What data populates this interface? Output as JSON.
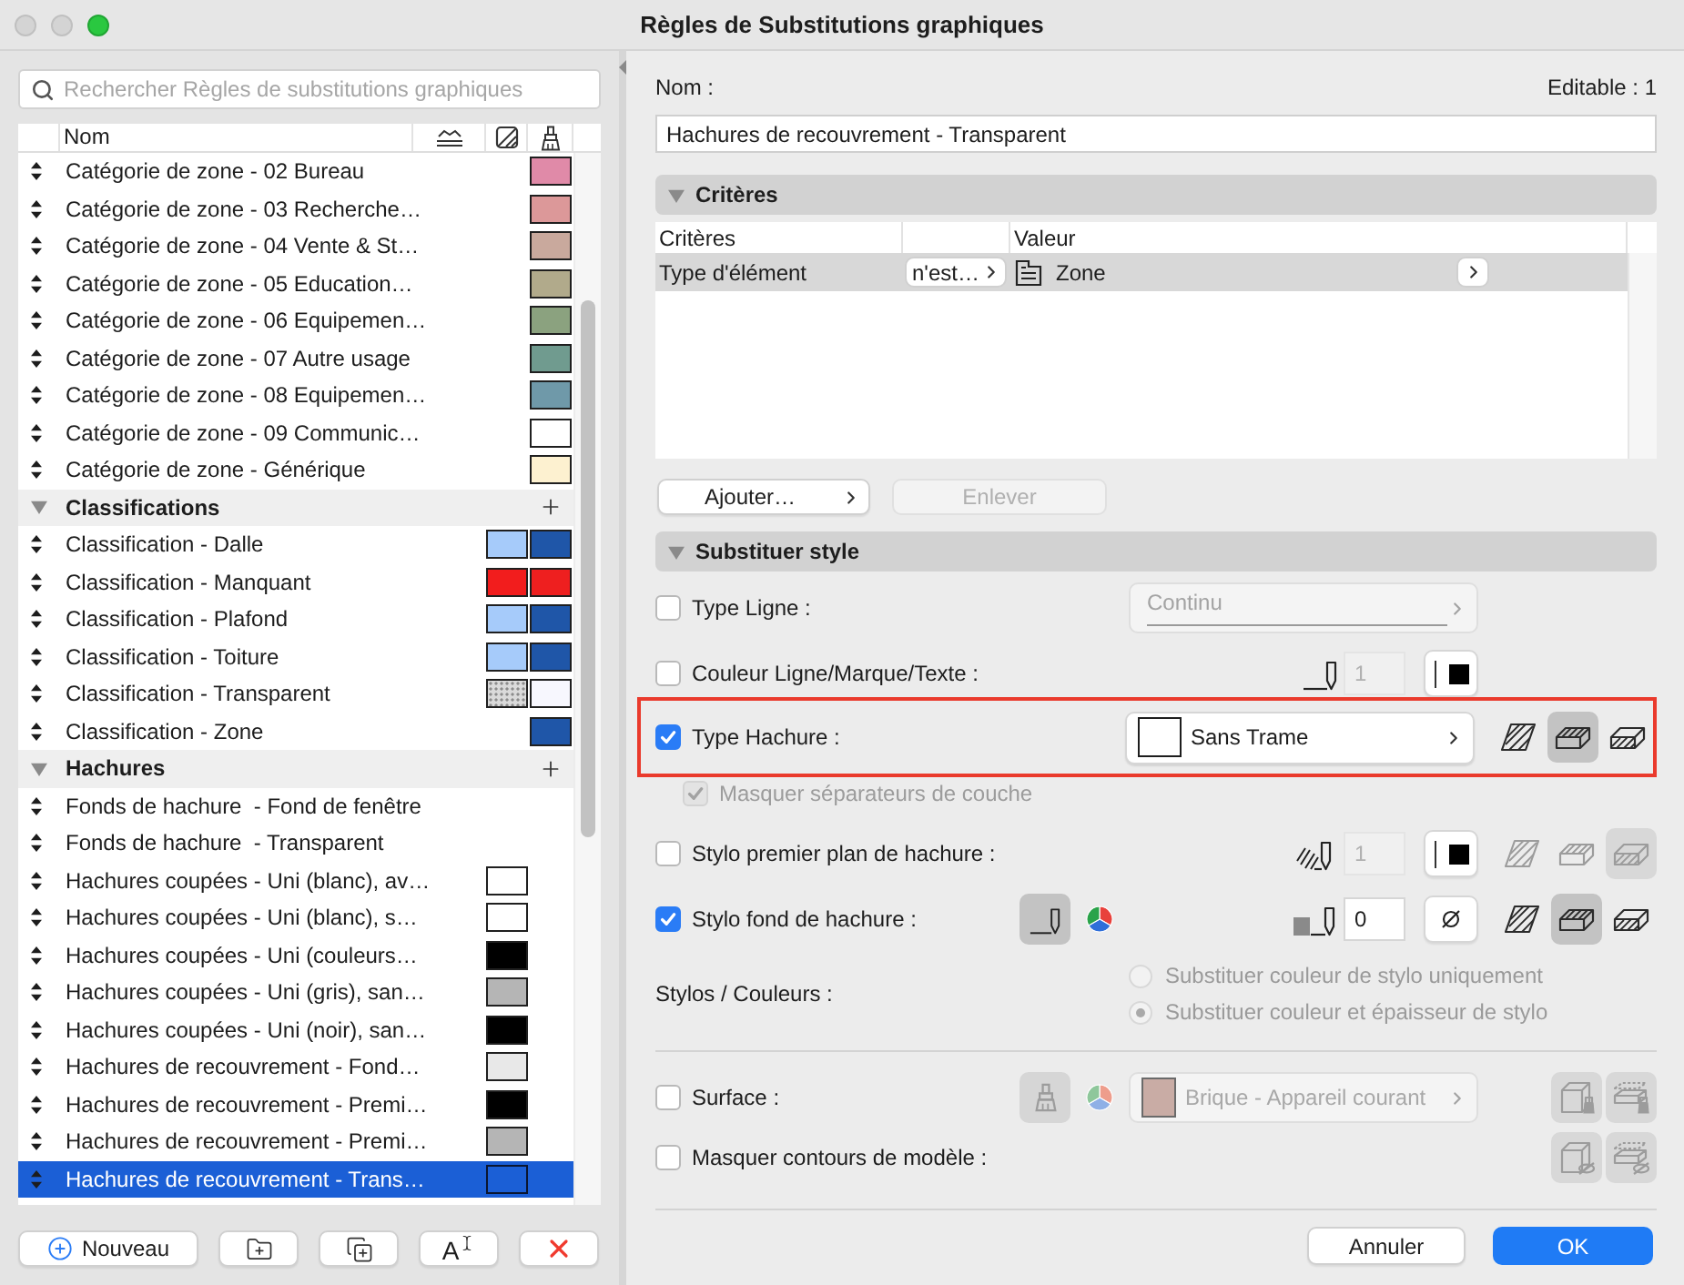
{
  "window": {
    "title": "Règles de Substitutions graphiques"
  },
  "rules_panel": {
    "search": {
      "placeholder": "Rechercher Règles de substitutions graphiques"
    },
    "name_column": "Nom",
    "rows": [
      {
        "kind": "rule",
        "name": "Catégorie de zone - 02 Bureau",
        "selected": false,
        "surface_swatch": {
          "kind": "solid",
          "color": "#e08aa8"
        }
      },
      {
        "kind": "rule",
        "name": "Catégorie de zone - 03 Recherche…",
        "selected": false,
        "surface_swatch": {
          "kind": "solid",
          "color": "#dc9899"
        }
      },
      {
        "kind": "rule",
        "name": "Catégorie de zone - 04 Vente & St…",
        "selected": false,
        "surface_swatch": {
          "kind": "solid",
          "color": "#c9a99d"
        }
      },
      {
        "kind": "rule",
        "name": "Catégorie de zone - 05 Education…",
        "selected": false,
        "surface_swatch": {
          "kind": "solid",
          "color": "#b1aa8b"
        }
      },
      {
        "kind": "rule",
        "name": "Catégorie de zone - 06 Equipemen…",
        "selected": false,
        "surface_swatch": {
          "kind": "solid",
          "color": "#8ba27f"
        }
      },
      {
        "kind": "rule",
        "name": "Catégorie de zone - 07 Autre usage",
        "selected": false,
        "surface_swatch": {
          "kind": "solid",
          "color": "#709b8f"
        }
      },
      {
        "kind": "rule",
        "name": "Catégorie de zone - 08 Equipemen…",
        "selected": false,
        "surface_swatch": {
          "kind": "solid",
          "color": "#6f99a9"
        }
      },
      {
        "kind": "rule",
        "name": "Catégorie de zone - 09 Communic…",
        "selected": false,
        "surface_swatch": {
          "kind": "solid",
          "color": "#ffffff"
        }
      },
      {
        "kind": "rule",
        "name": "Catégorie de zone - Générique",
        "selected": false,
        "surface_swatch": {
          "kind": "solid",
          "color": "#fdf1d0"
        }
      },
      {
        "kind": "group",
        "name": "Classifications",
        "expanded": true
      },
      {
        "kind": "rule",
        "name": "Classification - Dalle",
        "selected": false,
        "fill_swatch": {
          "kind": "solid",
          "color": "#a6cbfa"
        },
        "surface_swatch": {
          "kind": "solid",
          "color": "#1f56a8"
        }
      },
      {
        "kind": "rule",
        "name": "Classification - Manquant",
        "selected": false,
        "fill_swatch": {
          "kind": "solid",
          "color": "#f21d1d"
        },
        "surface_swatch": {
          "kind": "solid",
          "color": "#ee1f1f"
        }
      },
      {
        "kind": "rule",
        "name": "Classification - Plafond",
        "selected": false,
        "fill_swatch": {
          "kind": "solid",
          "color": "#a6cbfa"
        },
        "surface_swatch": {
          "kind": "solid",
          "color": "#1f56a8"
        }
      },
      {
        "kind": "rule",
        "name": "Classification - Toiture",
        "selected": false,
        "fill_swatch": {
          "kind": "solid",
          "color": "#a6cbfa"
        },
        "surface_swatch": {
          "kind": "solid",
          "color": "#1f56a8"
        }
      },
      {
        "kind": "rule",
        "name": "Classification - Transparent",
        "selected": false,
        "fill_swatch": {
          "kind": "dotted",
          "color": "#dadada"
        },
        "surface_swatch": {
          "kind": "solid",
          "color": "#f7f7fe"
        }
      },
      {
        "kind": "rule",
        "name": "Classification - Zone",
        "selected": false,
        "surface_swatch": {
          "kind": "solid",
          "color": "#1f56a8"
        }
      },
      {
        "kind": "group",
        "name": "Hachures",
        "expanded": true
      },
      {
        "kind": "rule",
        "name": "Fonds de hachure  - Fond de fenêtre",
        "selected": false
      },
      {
        "kind": "rule",
        "name": "Fonds de hachure  - Transparent",
        "selected": false
      },
      {
        "kind": "rule",
        "name": "Hachures coupées - Uni (blanc), av…",
        "selected": false,
        "fill_swatch": {
          "kind": "solid",
          "color": "#ffffff"
        }
      },
      {
        "kind": "rule",
        "name": "Hachures coupées - Uni (blanc), s…",
        "selected": false,
        "fill_swatch": {
          "kind": "solid",
          "color": "#ffffff"
        }
      },
      {
        "kind": "rule",
        "name": "Hachures coupées - Uni (couleurs…",
        "selected": false,
        "fill_swatch": {
          "kind": "solid",
          "color": "#000000"
        }
      },
      {
        "kind": "rule",
        "name": "Hachures coupées - Uni (gris), san…",
        "selected": false,
        "fill_swatch": {
          "kind": "solid",
          "color": "#b5b5b5"
        }
      },
      {
        "kind": "rule",
        "name": "Hachures coupées - Uni (noir), san…",
        "selected": false,
        "fill_swatch": {
          "kind": "solid",
          "color": "#000000"
        }
      },
      {
        "kind": "rule",
        "name": "Hachures de recouvrement - Fond…",
        "selected": false,
        "fill_swatch": {
          "kind": "solid",
          "color": "#e8e8e8"
        }
      },
      {
        "kind": "rule",
        "name": "Hachures de recouvrement - Premi…",
        "selected": false,
        "fill_swatch": {
          "kind": "solid",
          "color": "#000000"
        }
      },
      {
        "kind": "rule",
        "name": "Hachures de recouvrement - Premi…",
        "selected": false,
        "fill_swatch": {
          "kind": "solid",
          "color": "#b5b5b5"
        }
      },
      {
        "kind": "rule",
        "name": "Hachures de recouvrement - Trans…",
        "selected": true,
        "fill_swatch": {
          "kind": "empty"
        }
      }
    ],
    "buttons": {
      "new": "Nouveau",
      "rename": "A"
    }
  },
  "editor": {
    "name_label": "Nom :",
    "editable": "Editable : 1",
    "name_value": "Hachures de recouvrement - Transparent",
    "criteria": {
      "title": "Critères",
      "expanded": true,
      "criterion_header": "Critères",
      "value_header": "Valeur",
      "rows": [
        {
          "criterion": "Type d'élément",
          "operator": "n'est…",
          "value": "Zone",
          "selected": true
        }
      ],
      "add_button": "Ajouter…",
      "remove_button": {
        "label": "Enlever",
        "disabled": true
      }
    },
    "style": {
      "title": "Substituer style",
      "expanded": true,
      "rows": [
        {
          "kind": "line_type",
          "label": "Type Ligne :",
          "checked": false,
          "popup": {
            "value": "Continu"
          }
        },
        {
          "kind": "pen_color",
          "label": "Couleur Ligne/Marque/Texte :",
          "checked": false,
          "pen_number": "1",
          "pen_chip": {
            "color": "#000000"
          }
        },
        {
          "kind": "fill_type",
          "label": "Type Hachure :",
          "checked": true,
          "highlighted": true,
          "popup": {
            "value": "Sans Trame"
          },
          "modes": [
            {
              "kind": "flat",
              "selected": false
            },
            {
              "kind": "top",
              "selected": true
            },
            {
              "kind": "side",
              "selected": false
            }
          ]
        },
        {
          "kind": "sub_option",
          "label": "Masquer séparateurs de couche",
          "checked": true,
          "disabled": true
        },
        {
          "kind": "fill_pen",
          "label": "Stylo premier plan de hachure :",
          "checked": false,
          "pen_number": "1",
          "pen_chip": {
            "color": "#000000"
          },
          "modes": [
            {
              "kind": "flat",
              "selected": false
            },
            {
              "kind": "top",
              "selected": false
            },
            {
              "kind": "side",
              "selected": true
            }
          ]
        },
        {
          "kind": "fill_background_pen",
          "label": "Stylo fond de hachure :",
          "checked": true,
          "pen_button": {
            "selected": true
          },
          "pen_number": "0",
          "modes": [
            {
              "kind": "flat",
              "selected": false
            },
            {
              "kind": "top",
              "selected": true
            },
            {
              "kind": "side",
              "selected": false
            }
          ]
        },
        {
          "kind": "radio_group",
          "label": "Stylos / Couleurs :",
          "disabled": true,
          "options": [
            {
              "label": "Substituer couleur de stylo uniquement",
              "selected": false
            },
            {
              "label": "Substituer couleur et épaisseur de stylo",
              "selected": true
            }
          ]
        },
        {
          "kind": "divider"
        },
        {
          "kind": "surface",
          "label": "Surface :",
          "checked": false,
          "brush_button": {
            "selected": true
          },
          "popup": {
            "value": "Brique - Appareil courant",
            "color": "#c9aca5"
          },
          "modes": [
            {
              "kind": "cube",
              "selected": true
            },
            {
              "kind": "layers",
              "selected": true
            }
          ]
        },
        {
          "kind": "hide_contours",
          "label": "Masquer contours de modèle :",
          "checked": false,
          "modes": [
            {
              "kind": "cube",
              "selected": true
            },
            {
              "kind": "layers",
              "selected": true
            }
          ]
        }
      ]
    },
    "cancel_button": "Annuler",
    "ok_button": "OK"
  }
}
